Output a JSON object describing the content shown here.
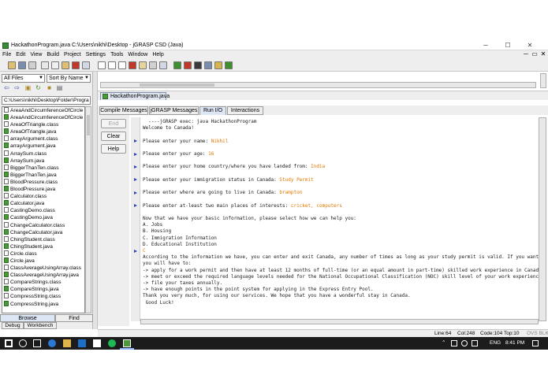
{
  "window": {
    "title": "HackathonProgram.java  C:\\Users\\nikhi\\Desktop - jGRASP CSD (Java)",
    "controls": {
      "minimize": "─",
      "maximize": "☐",
      "close": "✕"
    }
  },
  "menu": {
    "items": [
      "File",
      "Edit",
      "View",
      "Build",
      "Project",
      "Settings",
      "Tools",
      "Window",
      "Help"
    ],
    "restore_controls": {
      "minimize": "─",
      "restore": "▭",
      "close": "✕"
    }
  },
  "toolbar": {
    "icons": [
      "open-folder-icon",
      "save-icon",
      "print-icon",
      "cut-icon",
      "copy-icon",
      "paste-icon",
      "delete-icon",
      "undo-icon",
      "generate-csd-icon",
      "remove-csd-icon",
      "new-file-icon",
      "new-project-icon",
      "breakpoint-icon",
      "bookmark-icon",
      "document-icon",
      "compile-icon",
      "debug-icon",
      "run-icon",
      "jar-icon",
      "step-icon",
      "bug-icon"
    ],
    "colors": {
      "icon_green": "#3f8f2f",
      "icon_red": "#c0392b",
      "icon_yellow": "#d9b44a"
    }
  },
  "browser": {
    "filter": "All Files",
    "sort": "Sort By Name",
    "path": "C:\\Users\\nikhi\\Desktop\\Folder\\Progra",
    "files": [
      {
        "name": "AreaAndCircumferenceOfCircle",
        "type": "class"
      },
      {
        "name": "AreaAndCircumferenceOfCircle",
        "type": "java"
      },
      {
        "name": "AreaOfTriangle.class",
        "type": "class"
      },
      {
        "name": "AreaOfTriangle.java",
        "type": "java"
      },
      {
        "name": "arrayArgument.class",
        "type": "class"
      },
      {
        "name": "arrayArgument.java",
        "type": "java"
      },
      {
        "name": "ArraySum.class",
        "type": "class"
      },
      {
        "name": "ArraySum.java",
        "type": "java"
      },
      {
        "name": "BiggerThanTen.class",
        "type": "class"
      },
      {
        "name": "BiggerThanTen.java",
        "type": "java"
      },
      {
        "name": "BloodPressure.class",
        "type": "class"
      },
      {
        "name": "BloodPressure.java",
        "type": "java"
      },
      {
        "name": "Calculator.class",
        "type": "class"
      },
      {
        "name": "Calculator.java",
        "type": "java"
      },
      {
        "name": "CastingDemo.class",
        "type": "class"
      },
      {
        "name": "CastingDemo.java",
        "type": "java"
      },
      {
        "name": "ChangeCalculator.class",
        "type": "class"
      },
      {
        "name": "ChangeCalculator.java",
        "type": "java"
      },
      {
        "name": "ChingStudent.class",
        "type": "class"
      },
      {
        "name": "ChingStudent.java",
        "type": "java"
      },
      {
        "name": "Circle.class",
        "type": "class"
      },
      {
        "name": "Circle.java",
        "type": "java"
      },
      {
        "name": "ClassAverageUsingArray.class",
        "type": "class"
      },
      {
        "name": "ClassAverageUsingArray.java",
        "type": "java"
      },
      {
        "name": "CompareStrings.class",
        "type": "class"
      },
      {
        "name": "CompareStrings.java",
        "type": "java"
      },
      {
        "name": "CompressString.class",
        "type": "class"
      },
      {
        "name": "CompressString.java",
        "type": "java"
      }
    ],
    "tabs": {
      "browse": "Browse",
      "find": "Find"
    },
    "bottom_tabs": {
      "debug": "Debug",
      "workbench": "Workbench"
    }
  },
  "editor": {
    "file_tab": "HackathonProgram.java"
  },
  "messages": {
    "tabs": [
      "Compile Messages",
      "jGRASP Messages",
      "Run I/O",
      "Interactions"
    ],
    "active_tab": "Run I/O",
    "buttons": {
      "end": "End",
      "clear": "Clear",
      "help": "Help"
    },
    "console": [
      {
        "text": "  ----jGRASP exec: java HackathonProgram",
        "input": ""
      },
      {
        "text": "Welcome to Canada!",
        "input": ""
      },
      {
        "text": "",
        "input": ""
      },
      {
        "text": "Please enter your name: ",
        "input": "Nikhil"
      },
      {
        "text": "",
        "input": ""
      },
      {
        "text": "Please enter your age: ",
        "input": "16"
      },
      {
        "text": "",
        "input": ""
      },
      {
        "text": "Please enter your home country/where you have landed from: ",
        "input": "India"
      },
      {
        "text": "",
        "input": ""
      },
      {
        "text": "Please enter your immigration status in Canada: ",
        "input": "Study Permit"
      },
      {
        "text": "",
        "input": ""
      },
      {
        "text": "Please enter where are going to live in Canada: ",
        "input": "brampton"
      },
      {
        "text": "",
        "input": ""
      },
      {
        "text": "Please enter at-least two main places of interests: ",
        "input": "cricket, computers"
      },
      {
        "text": "",
        "input": ""
      },
      {
        "text": "Now that we have your basic information, please select how we can help you:",
        "input": ""
      },
      {
        "text": "A. Jobs",
        "input": ""
      },
      {
        "text": "B. Housing",
        "input": ""
      },
      {
        "text": "C. Immigration Information",
        "input": ""
      },
      {
        "text": "D. Educational Institution",
        "input": ""
      },
      {
        "text": "",
        "input": "C"
      },
      {
        "text": "According to the information we have, you can enter and exit Canada, any number of times as long as your study permit is valid. If you want",
        "input": ""
      },
      {
        "text": "you will have to:",
        "input": ""
      },
      {
        "text": "-> apply for a work permit and then have at least 12 months of full-time (or an equal amount in part-time) skilled work experience in Canada",
        "input": ""
      },
      {
        "text": "-> meet or exceed the required language levels needed for the National Occupational Classification (NOC) skill level of your work experience",
        "input": ""
      },
      {
        "text": "-> file your taxes annually.",
        "input": ""
      },
      {
        "text": "-> have enough points in the point system for applying in the Express Entry Pool.",
        "input": ""
      },
      {
        "text": "Thank you very much, for using our services. We hope that you have a wonderful stay in Canada.",
        "input": ""
      },
      {
        "text": " Good Luck!",
        "input": ""
      }
    ],
    "input_color": "#e07800"
  },
  "status": {
    "line": "Line:64",
    "col": "Col:248",
    "code": "Code:104",
    "top": "Top:10",
    "ovs": "OVS BLK"
  },
  "taskbar": {
    "icons": [
      "windows-start-icon",
      "cortana-icon",
      "task-view-icon",
      "edge-icon",
      "explorer-icon",
      "store-icon",
      "mail-icon",
      "spotify-icon",
      "jgrasp-icon"
    ],
    "tray": {
      "lang": "ENG",
      "time": "8:41 PM"
    }
  }
}
